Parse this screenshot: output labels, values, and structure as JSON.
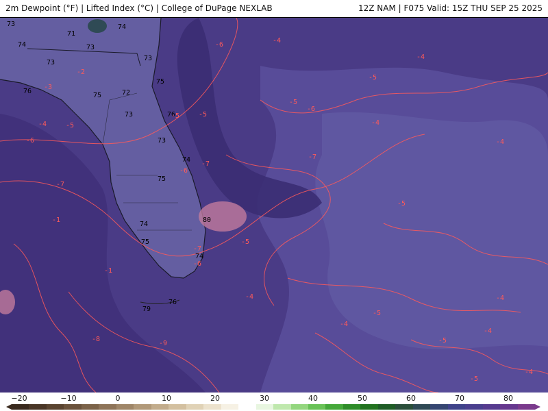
{
  "header": {
    "left": "2m Dewpoint (°F) | Lifted Index (°C) | College of DuPage NEXLAB",
    "right": "12Z NAM | F075 Valid: 15Z THU SEP 25 2025"
  },
  "colors": {
    "base": "#4a3b86",
    "dark": "#3b2d73",
    "light": "#5d54a0",
    "land": "#6a68a8",
    "contour": "#ff5a5a"
  },
  "dewpoint_labels": [
    "73",
    "71",
    "74",
    "71",
    "73",
    "74",
    "73",
    "73",
    "76",
    "75",
    "72",
    "73",
    "75",
    "73",
    "74",
    "75",
    "74",
    "75",
    "80",
    "74",
    "76",
    "76",
    "79"
  ],
  "lifted_labels": [
    "-6",
    "-4",
    "-2",
    "-3",
    "-5",
    "-4",
    "-5",
    "-6",
    "-5",
    "-5",
    "-4",
    "-6",
    "-7",
    "-6",
    "-7",
    "-7",
    "-5",
    "-7",
    "-6",
    "-4",
    "-5",
    "-4",
    "-4",
    "-5",
    "-4",
    "-8",
    "-9",
    "-1",
    "-1",
    "-4",
    "-4",
    "-4",
    "-5",
    "-5",
    "-5"
  ],
  "colorbar": {
    "ticks": [
      "−20",
      "−10",
      "0",
      "10",
      "20",
      "30",
      "40",
      "50",
      "60",
      "70",
      "80"
    ],
    "colors": [
      "#3a2a1e",
      "#4a3626",
      "#5a4430",
      "#6b533c",
      "#7c6349",
      "#8e7458",
      "#9f8668",
      "#b19979",
      "#c2ac8c",
      "#d3c0a0",
      "#e0d2b6",
      "#ece2cd",
      "#f6f1e4",
      "#ffffff",
      "#e8f6e0",
      "#bfe8ad",
      "#93d67e",
      "#69c257",
      "#45a83a",
      "#2f8d29",
      "#22731f",
      "#1f5d26",
      "#2a4f3a",
      "#2f4a55",
      "#354672",
      "#3f438a",
      "#4a3f8e",
      "#563b8f",
      "#66388e",
      "#7a3a8c"
    ]
  }
}
